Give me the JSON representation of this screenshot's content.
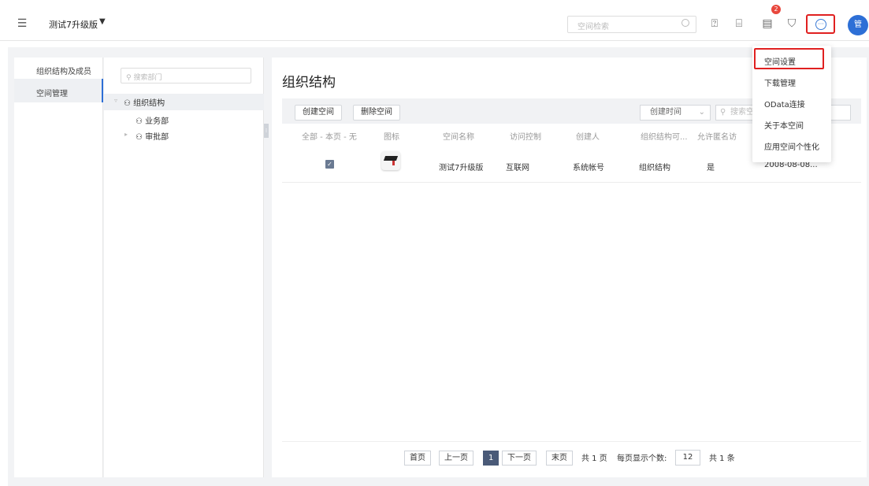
{
  "topbar": {
    "space_name": "测试7升级版",
    "search_placeholder": "空间检索",
    "notification_count": "2",
    "avatar_text": "管"
  },
  "left_nav": {
    "items": [
      {
        "label": "组织结构及成员"
      },
      {
        "label": "空间管理"
      }
    ]
  },
  "tree": {
    "search_placeholder": "搜索部门",
    "nodes": [
      {
        "label": "组织结构"
      },
      {
        "label": "业务部"
      },
      {
        "label": "审批部"
      }
    ]
  },
  "main": {
    "title": "组织结构",
    "toolbar": {
      "create_label": "创建空间",
      "delete_label": "删除空间",
      "sort_label": "创建时间",
      "search_placeholder": "搜索空"
    },
    "table": {
      "headers": [
        "全部 - 本页 - 无",
        "图标",
        "空间名称",
        "访问控制",
        "创建人",
        "组织结构可...",
        "允许匿名访"
      ],
      "rows": [
        {
          "name": "测试7升级版",
          "access": "互联网",
          "creator": "系统帐号",
          "org": "组织结构",
          "anon": "是",
          "date": "2008-08-08..."
        }
      ]
    },
    "pager": {
      "first": "首页",
      "prev": "上一页",
      "current": "1",
      "next": "下一页",
      "last": "末页",
      "total_pages": "共 1 页",
      "per_page_label": "每页显示个数:",
      "per_page_value": "12",
      "total_items": "共 1 条"
    }
  },
  "dropdown": {
    "items": [
      "空间设置",
      "下载管理",
      "OData连接",
      "关于本空间",
      "应用空间个性化"
    ]
  }
}
